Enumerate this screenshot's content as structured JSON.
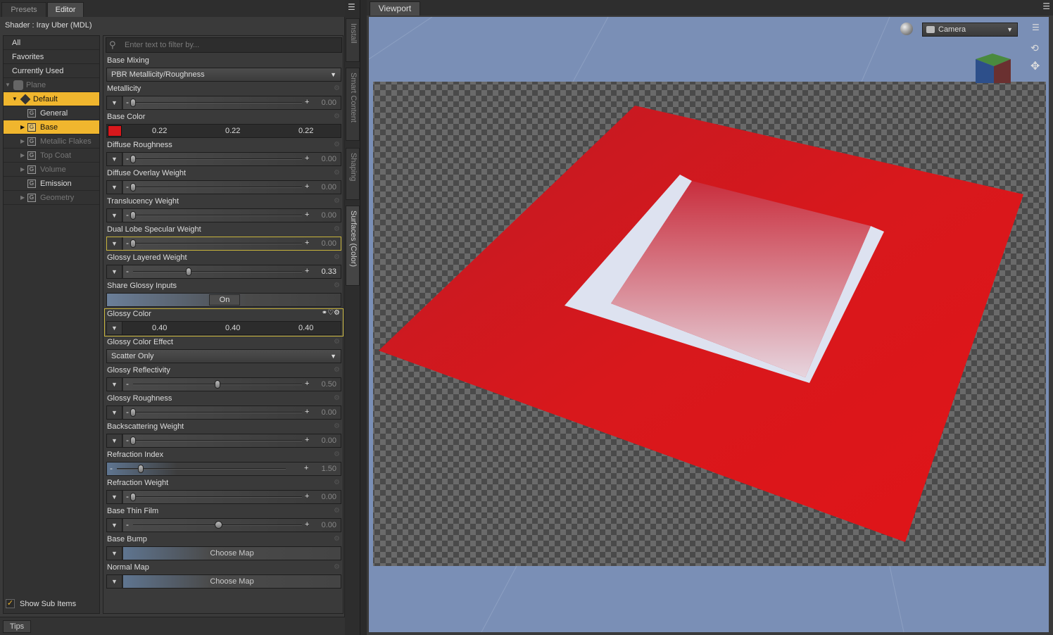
{
  "left_tabs": [
    "Presets",
    "Editor"
  ],
  "shader_label": "Shader :  Iray Uber (MDL)",
  "tree": {
    "items": [
      {
        "label": "All",
        "state": "normal"
      },
      {
        "label": "Favorites",
        "state": "normal"
      },
      {
        "label": "Currently Used",
        "state": "normal"
      },
      {
        "label": "Plane",
        "state": "dim"
      },
      {
        "label": "Default",
        "state": "selected"
      },
      {
        "label": "General",
        "state": "normal"
      },
      {
        "label": "Base",
        "state": "selected"
      },
      {
        "label": "Metallic Flakes",
        "state": "dim"
      },
      {
        "label": "Top Coat",
        "state": "dim"
      },
      {
        "label": "Volume",
        "state": "dim"
      },
      {
        "label": "Emission",
        "state": "normal"
      },
      {
        "label": "Geometry",
        "state": "dim"
      }
    ],
    "show_sub_items": "Show Sub Items"
  },
  "filter_placeholder": "Enter text to filter by...",
  "props": {
    "base_mixing": {
      "label": "Base Mixing",
      "value": "PBR Metallicity/Roughness"
    },
    "metallicity": {
      "label": "Metallicity",
      "value": "0.00",
      "fraction": 0.0
    },
    "base_color": {
      "label": "Base Color",
      "r": "0.22",
      "g": "0.22",
      "b": "0.22",
      "swatch": "#d8181c"
    },
    "diffuse_roughness": {
      "label": "Diffuse Roughness",
      "value": "0.00",
      "fraction": 0.0
    },
    "diffuse_overlay_weight": {
      "label": "Diffuse Overlay Weight",
      "value": "0.00",
      "fraction": 0.0
    },
    "translucency_weight": {
      "label": "Translucency Weight",
      "value": "0.00",
      "fraction": 0.0
    },
    "dual_lobe_specular_weight": {
      "label": "Dual Lobe Specular Weight",
      "value": "0.00",
      "fraction": 0.0
    },
    "glossy_layered_weight": {
      "label": "Glossy Layered Weight",
      "value": "0.33",
      "fraction": 0.33
    },
    "share_glossy_inputs": {
      "label": "Share Glossy Inputs",
      "value": "On"
    },
    "glossy_color": {
      "label": "Glossy Color",
      "r": "0.40",
      "g": "0.40",
      "b": "0.40"
    },
    "glossy_color_effect": {
      "label": "Glossy Color Effect",
      "value": "Scatter Only"
    },
    "glossy_reflectivity": {
      "label": "Glossy Reflectivity",
      "value": "0.50",
      "fraction": 0.5
    },
    "glossy_roughness": {
      "label": "Glossy Roughness",
      "value": "0.00",
      "fraction": 0.0
    },
    "backscattering_weight": {
      "label": "Backscattering Weight",
      "value": "0.00",
      "fraction": 0.0
    },
    "refraction_index": {
      "label": "Refraction Index",
      "value": "1.50",
      "fraction": 0.14
    },
    "refraction_weight": {
      "label": "Refraction Weight",
      "value": "0.00",
      "fraction": 0.0
    },
    "base_thin_film": {
      "label": "Base Thin Film",
      "value": "0.00",
      "fraction": 0.5
    },
    "base_bump": {
      "label": "Base Bump",
      "value": "Choose Map"
    },
    "normal_map": {
      "label": "Normal Map",
      "value": "Choose Map"
    }
  },
  "side_tabs": [
    "Install",
    "Smart Content",
    "Shaping",
    "Surfaces (Color)"
  ],
  "tips_label": "Tips",
  "viewport": {
    "tab": "Viewport",
    "camera": "Camera",
    "background_color": "#7a8fb6",
    "plane_color": "#d8181c"
  }
}
